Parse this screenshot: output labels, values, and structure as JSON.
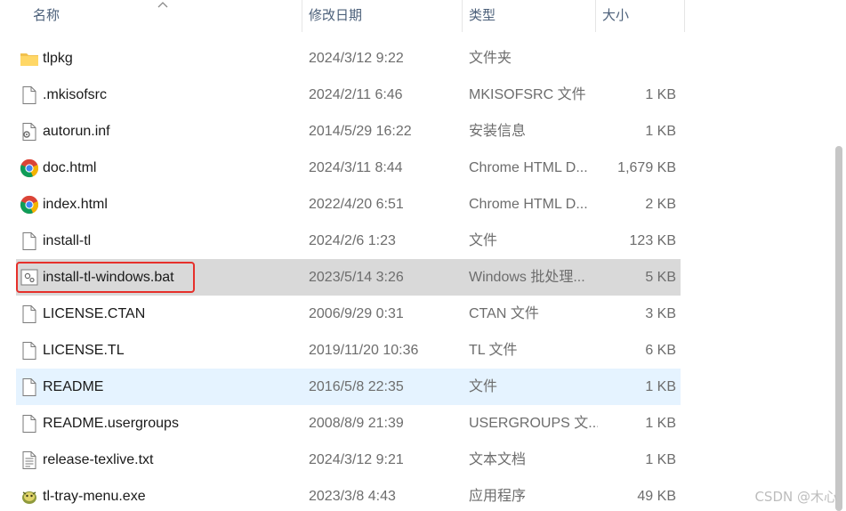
{
  "header": {
    "name": "名称",
    "date": "修改日期",
    "type": "类型",
    "size": "大小"
  },
  "files": [
    {
      "name": "tlpkg",
      "date": "2024/3/12 9:22",
      "type": "文件夹",
      "size": "",
      "icon": "folder-icon"
    },
    {
      "name": ".mkisofsrc",
      "date": "2024/2/11 6:46",
      "type": "MKISOFSRC 文件",
      "size": "1 KB",
      "icon": "file-icon"
    },
    {
      "name": "autorun.inf",
      "date": "2014/5/29 16:22",
      "type": "安装信息",
      "size": "1 KB",
      "icon": "settings-file-icon"
    },
    {
      "name": "doc.html",
      "date": "2024/3/11 8:44",
      "type": "Chrome HTML D...",
      "size": "1,679 KB",
      "icon": "chrome-icon"
    },
    {
      "name": "index.html",
      "date": "2022/4/20 6:51",
      "type": "Chrome HTML D...",
      "size": "2 KB",
      "icon": "chrome-icon"
    },
    {
      "name": "install-tl",
      "date": "2024/2/6 1:23",
      "type": "文件",
      "size": "123 KB",
      "icon": "file-icon"
    },
    {
      "name": "install-tl-windows.bat",
      "date": "2023/5/14 3:26",
      "type": "Windows 批处理...",
      "size": "5 KB",
      "icon": "batch-file-icon"
    },
    {
      "name": "LICENSE.CTAN",
      "date": "2006/9/29 0:31",
      "type": "CTAN 文件",
      "size": "3 KB",
      "icon": "file-icon"
    },
    {
      "name": "LICENSE.TL",
      "date": "2019/11/20 10:36",
      "type": "TL 文件",
      "size": "6 KB",
      "icon": "file-icon"
    },
    {
      "name": "README",
      "date": "2016/5/8 22:35",
      "type": "文件",
      "size": "1 KB",
      "icon": "file-icon"
    },
    {
      "name": "README.usergroups",
      "date": "2008/8/9 21:39",
      "type": "USERGROUPS 文...",
      "size": "1 KB",
      "icon": "file-icon"
    },
    {
      "name": "release-texlive.txt",
      "date": "2024/3/12 9:21",
      "type": "文本文档",
      "size": "1 KB",
      "icon": "text-file-icon"
    },
    {
      "name": "tl-tray-menu.exe",
      "date": "2023/3/8 4:43",
      "type": "应用程序",
      "size": "49 KB",
      "icon": "exe-icon"
    }
  ],
  "watermark": "CSDN @木心",
  "colors": {
    "selected_row": "#d9d9d9",
    "hover_row": "#e5f3ff",
    "highlight_border": "#e6302b",
    "header_text": "#4c607a"
  }
}
